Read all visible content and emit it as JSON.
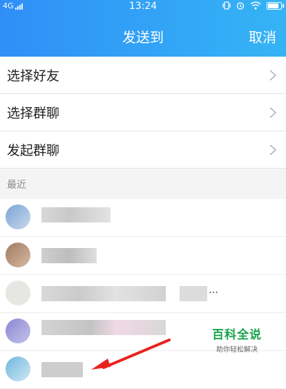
{
  "status": {
    "network": "4G",
    "time": "13:24"
  },
  "header": {
    "title": "发送到",
    "cancel": "取消"
  },
  "menu": [
    {
      "label": "选择好友"
    },
    {
      "label": "选择群聊"
    },
    {
      "label": "发起群聊"
    }
  ],
  "section": {
    "recent_label": "最近"
  },
  "recent": [
    {
      "name": ""
    },
    {
      "name": ""
    },
    {
      "name": "…"
    },
    {
      "name": ""
    },
    {
      "name": ""
    }
  ],
  "watermark": {
    "main": "百科全说",
    "sub": "助你轻松解决"
  },
  "colors": {
    "header_start": "#2f8ff7",
    "header_end": "#35b4f5",
    "watermark": "#18a24a"
  }
}
